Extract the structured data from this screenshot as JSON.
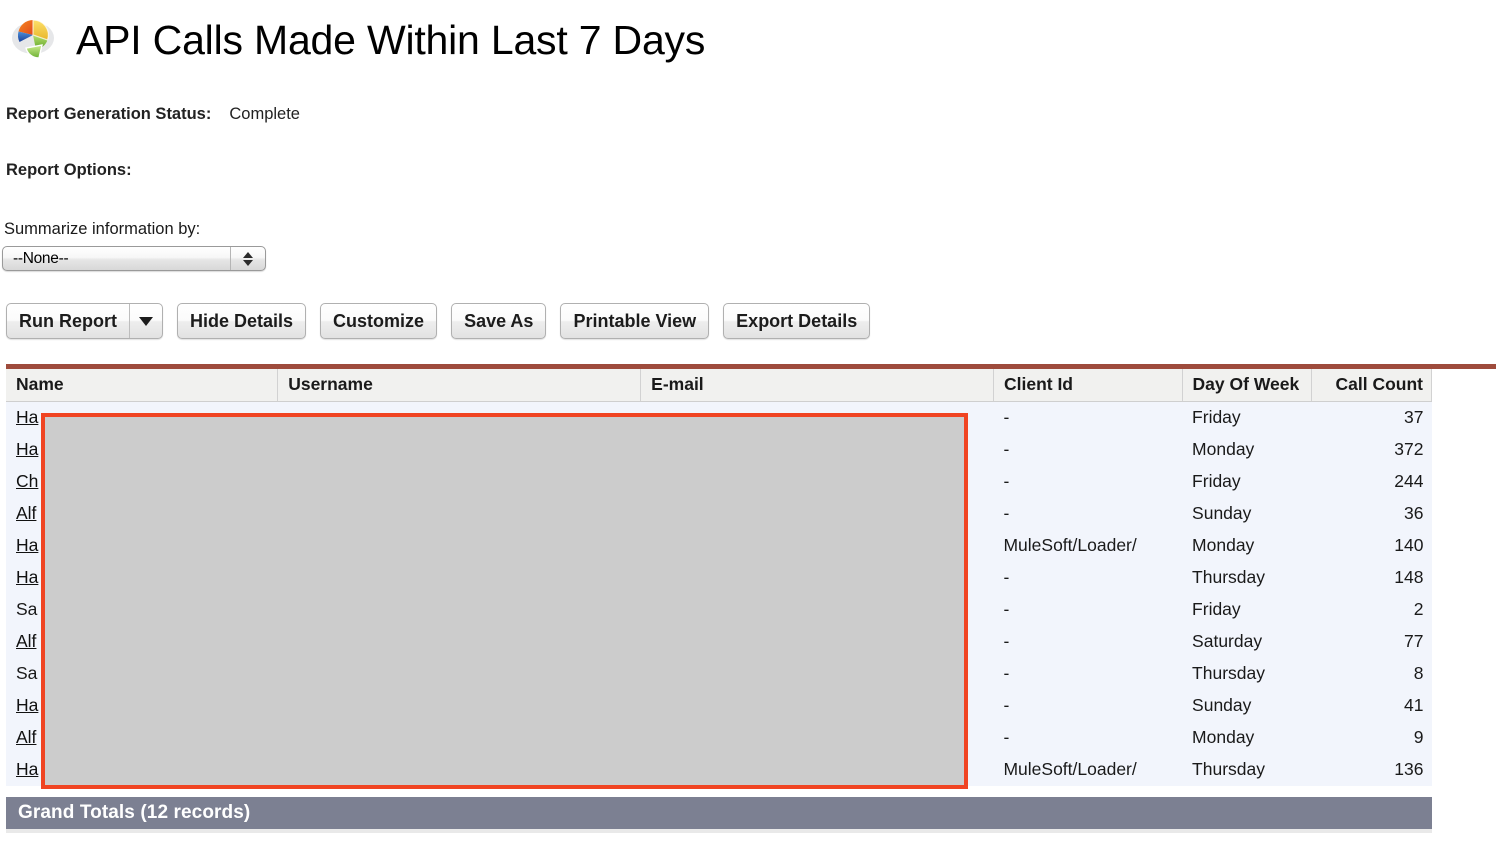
{
  "header": {
    "title": "API Calls Made Within Last 7 Days",
    "icon": "pie-chart-report-icon"
  },
  "status": {
    "label": "Report Generation Status:",
    "value": "Complete"
  },
  "options": {
    "section_label": "Report Options:",
    "summarize_label": "Summarize information by:",
    "summarize_value": "--None--"
  },
  "toolbar": {
    "run_report": "Run Report",
    "run_report_caret": "chevron-down-icon",
    "hide_details": "Hide Details",
    "customize": "Customize",
    "save_as": "Save As",
    "printable_view": "Printable View",
    "export_details": "Export Details"
  },
  "table": {
    "columns": [
      "Name",
      "Username",
      "E-mail",
      "Client Id",
      "Day Of Week",
      "Call Count"
    ],
    "rows": [
      {
        "name": "Ha",
        "name_link": true,
        "username": "",
        "email": "",
        "client_id": "-",
        "day": "Friday",
        "count": "37"
      },
      {
        "name": "Ha",
        "name_link": true,
        "username": "",
        "email": "",
        "client_id": "-",
        "day": "Monday",
        "count": "372"
      },
      {
        "name": "Ch",
        "name_link": true,
        "username": "",
        "email": "",
        "client_id": "-",
        "day": "Friday",
        "count": "244"
      },
      {
        "name": "Alf",
        "name_link": true,
        "username": "",
        "email": "",
        "client_id": "-",
        "day": "Sunday",
        "count": "36"
      },
      {
        "name": "Ha",
        "name_link": true,
        "username": "",
        "email": "",
        "client_id": "MuleSoft/Loader/",
        "day": "Monday",
        "count": "140"
      },
      {
        "name": "Ha",
        "name_link": true,
        "username": "",
        "email": "",
        "client_id": "-",
        "day": "Thursday",
        "count": "148"
      },
      {
        "name": "Sa",
        "name_link": false,
        "username": "",
        "email": "",
        "client_id": "-",
        "day": "Friday",
        "count": "2"
      },
      {
        "name": "Alf",
        "name_link": true,
        "username": "",
        "email": "",
        "client_id": "-",
        "day": "Saturday",
        "count": "77"
      },
      {
        "name": "Sa",
        "name_link": false,
        "username": "",
        "email": "",
        "client_id": "-",
        "day": "Thursday",
        "count": "8"
      },
      {
        "name": "Ha",
        "name_link": true,
        "username": "",
        "email": "",
        "client_id": "-",
        "day": "Sunday",
        "count": "41"
      },
      {
        "name": "Alf",
        "name_link": true,
        "username": "",
        "email": "",
        "client_id": "-",
        "day": "Monday",
        "count": "9"
      },
      {
        "name": "Ha",
        "name_link": true,
        "username": "",
        "email": "",
        "client_id": "MuleSoft/Loader/",
        "day": "Thursday",
        "count": "136"
      }
    ],
    "grand_totals": "Grand Totals (12 records)"
  },
  "colors": {
    "table_top_border": "#9e4b3c",
    "row_background": "#f2f5fc",
    "header_background": "#f1f1ef",
    "grand_totals_background": "#7c8092",
    "redaction_fill": "#cccccc",
    "redaction_border": "#f04422"
  },
  "redaction": {
    "name": "privacy-redaction-overlay"
  }
}
